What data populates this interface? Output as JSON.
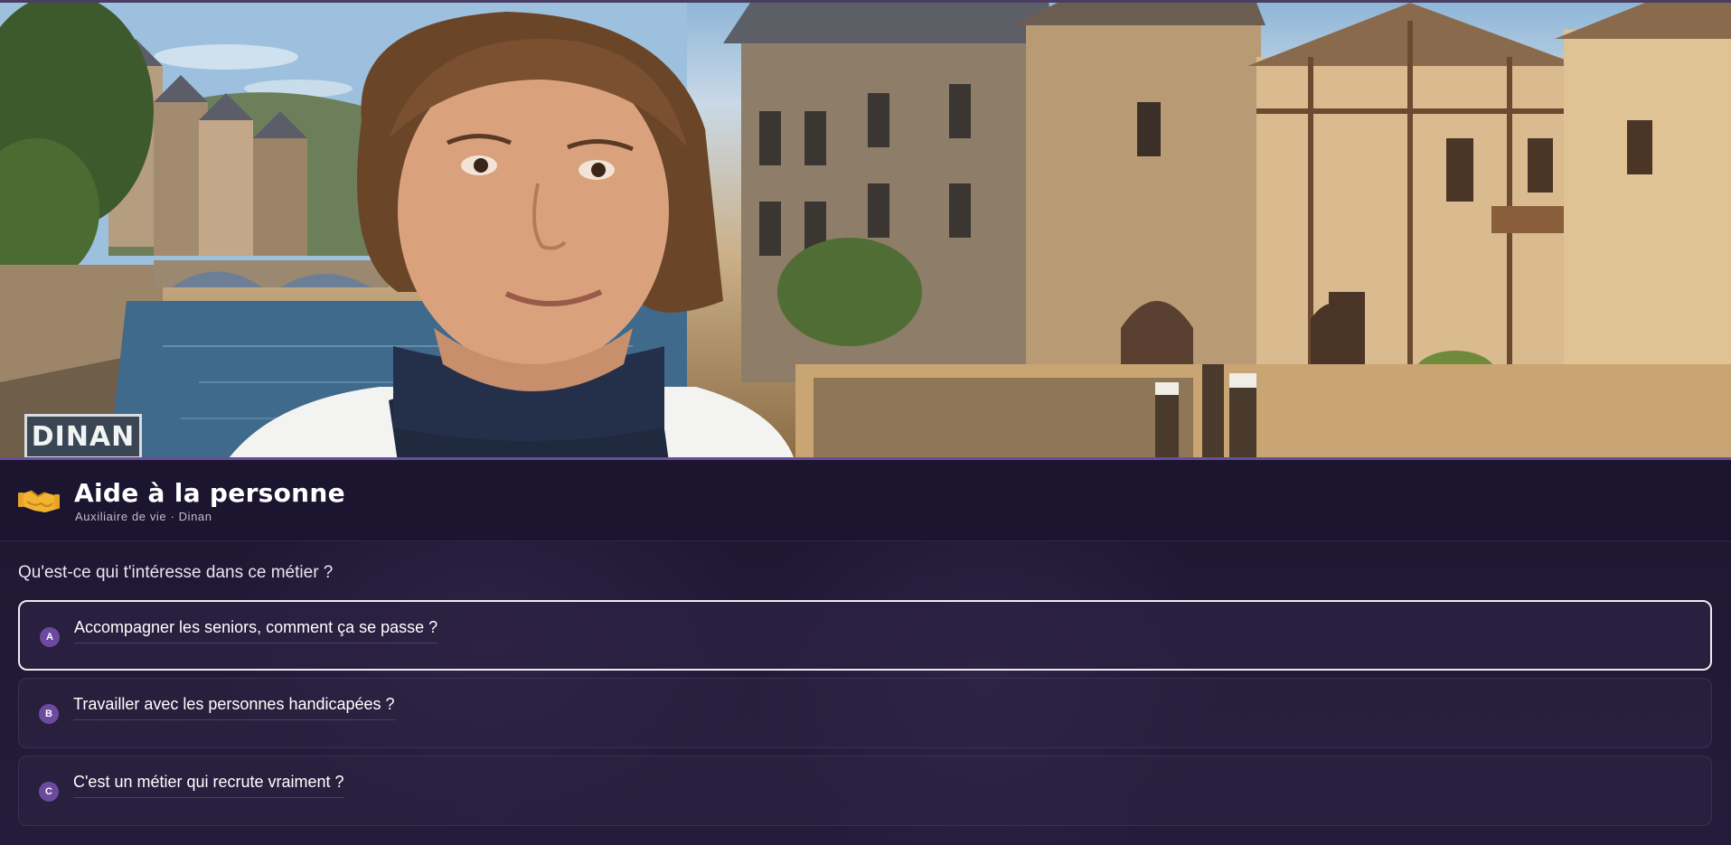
{
  "scene": {
    "sign_text": "DINAN",
    "accent_color": "#6a4e9a"
  },
  "header": {
    "icon": "handshake-icon",
    "title": "Aide à la personne",
    "subtitle": "Auxiliaire de vie · Dinan"
  },
  "question": {
    "prompt": "Qu'est-ce qui t'intéresse dans ce métier ?",
    "options": [
      {
        "letter": "A",
        "text": "Accompagner les seniors, comment ça se passe ?",
        "selected": true
      },
      {
        "letter": "B",
        "text": "Travailler avec les personnes handicapées ?",
        "selected": false
      },
      {
        "letter": "C",
        "text": "C'est un métier qui recrute vraiment ?",
        "selected": false
      }
    ]
  },
  "colors": {
    "background": "#1c1630",
    "badge": "#6c4aa0",
    "selected_border": "#ecebf2"
  }
}
